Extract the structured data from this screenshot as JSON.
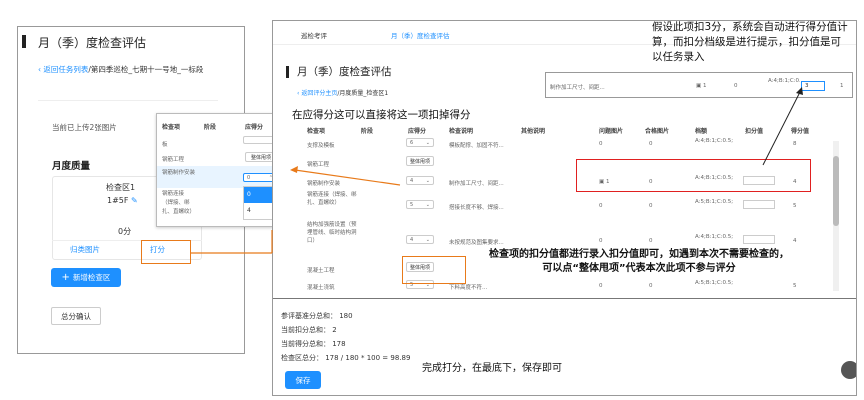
{
  "left": {
    "title": "月（季）度检查评估",
    "back_link": "返回任务列表",
    "breadcrumb": "/第四季巡检_七期十一号地_一标段",
    "upload_text": "当前已上传2张图片",
    "section_title": "月度质量",
    "area_name": "检查区1",
    "area_code": "1#5F",
    "score": "0分",
    "tab_photos": "归类图片",
    "tab_score": "打分",
    "add_area": "新增检查区",
    "total_confirm": "总分确认"
  },
  "popup": {
    "headers": [
      "检查项",
      "阶段",
      "应得分"
    ],
    "row0_item": "板",
    "row1_item": "钢筋工程",
    "row1_button": "整体甩项",
    "row2_item": "钢筋制作安装",
    "row2_select": "0",
    "options": [
      "0",
      "4"
    ],
    "row3_item": "钢筋连接（焊接、绑扎、直螺纹）"
  },
  "right": {
    "nav_item1": "巡检考评",
    "nav_item2": "月（季）度检查评估",
    "title": "月（季）度检查评估",
    "back_link": "返回评分主页",
    "breadcrumb": "/月度质量_检查区1",
    "headers": [
      "检查项",
      "阶段",
      "应得分",
      "检查说明",
      "其他说明",
      "问题图片",
      "合格图片",
      "档额",
      "扣分值",
      "得分值"
    ],
    "rows": [
      {
        "item": "支撑及模板",
        "score": "6",
        "desc": "模板配撑、加固不符...",
        "p1": "0",
        "p2": "0",
        "grade": "A:4;B:1;C:0.5;",
        "final": "8"
      },
      {
        "item": "钢筋工程",
        "button": "整体甩项"
      },
      {
        "item": "钢筋制作安装",
        "score": "4",
        "desc": "制作加工尺寸、间距...",
        "p1": "1",
        "p2": "0",
        "grade": "A:4;B:1;C:0.5;",
        "final": "4"
      },
      {
        "item": "钢筋连接（焊接、绑扎、直螺纹）",
        "score": "5",
        "desc": "搭接长度不够、焊接...",
        "p1": "0",
        "p2": "0",
        "grade": "A:5;B:1;C:0.5;",
        "final": "5"
      },
      {
        "item": "结构加强筋设置（预埋管线、临时结构洞口）",
        "score": "4",
        "desc": "未按规范及图集要求...",
        "p1": "0",
        "p2": "0",
        "grade": "A:4;B:1;C:0.5;",
        "final": "4"
      },
      {
        "item": "混凝土工程",
        "button": "整体甩项"
      },
      {
        "item": "混凝土浇筑",
        "score": "5",
        "desc": "下料高度不符...",
        "p1": "0",
        "p2": "0",
        "grade": "A:5;B:1;C:0.5;",
        "final": "5"
      }
    ],
    "zoom": {
      "item": "制作加工尺寸、间距...",
      "p1": "1",
      "p2": "0",
      "grade": "A:4;B:1;C:0.5;",
      "input": "3",
      "final": "1"
    },
    "summary": {
      "base": "参评基准分总和： 180",
      "deduct": "当前扣分总和： 2",
      "got": "当前得分总和： 178",
      "total": "检查区总分： 178 / 180 * 100 = 98.89"
    },
    "save": "保存"
  },
  "annotations": {
    "top_right": "假设此项扣3分，系统会自动进行得分值计算，而扣分档级是进行提示，扣分值是可以任务录入",
    "middle": "在应得分这可以直接将这一项扣掉得分",
    "bottom": "检查项的扣分值都进行录入扣分值即可，如遇到本次不需要检查的，可以点“整体甩项”代表本次此项不参与评分",
    "footer": "完成打分，在最底下，保存即可"
  },
  "colors": {
    "blue": "#1e90ff",
    "red": "#e02020",
    "orange": "#e87a1a"
  }
}
